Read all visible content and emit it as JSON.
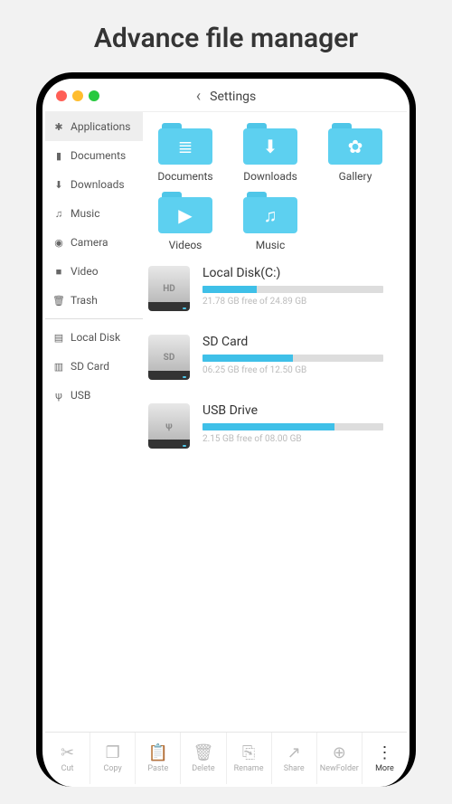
{
  "page_title": "Advance file manager",
  "topbar": {
    "label": "Settings"
  },
  "sidebar": {
    "primary": [
      {
        "icon": "✱",
        "label": "Applications",
        "active": true
      },
      {
        "icon": "▮",
        "label": "Documents"
      },
      {
        "icon": "⬇",
        "label": "Downloads"
      },
      {
        "icon": "♫",
        "label": "Music"
      },
      {
        "icon": "◉",
        "label": "Camera"
      },
      {
        "icon": "■",
        "label": "Video"
      },
      {
        "icon": "🗑",
        "label": "Trash"
      }
    ],
    "storage": [
      {
        "icon": "▤",
        "label": "Local Disk"
      },
      {
        "icon": "▥",
        "label": "SD Card"
      },
      {
        "icon": "ψ",
        "label": "USB"
      }
    ]
  },
  "folders": [
    {
      "name": "Documents",
      "glyph": "≣"
    },
    {
      "name": "Downloads",
      "glyph": "⬇"
    },
    {
      "name": "Gallery",
      "glyph": "✿"
    },
    {
      "name": "Videos",
      "glyph": "▶"
    },
    {
      "name": "Music",
      "glyph": "♫"
    }
  ],
  "drives": [
    {
      "badge": "HD",
      "name": "Local Disk(C:)",
      "free_text": "21.78 GB free of 24.89 GB",
      "pct": 30
    },
    {
      "badge": "SD",
      "name": "SD Card",
      "free_text": "06.25 GB free of 12.50 GB",
      "pct": 50
    },
    {
      "badge": "ψ",
      "name": "USB Drive",
      "free_text": "2.15 GB free of 08.00 GB",
      "pct": 73
    }
  ],
  "toolbar": [
    {
      "icon": "✂",
      "label": "Cut"
    },
    {
      "icon": "❐",
      "label": "Copy"
    },
    {
      "icon": "📋",
      "label": "Paste"
    },
    {
      "icon": "🗑",
      "label": "Delete"
    },
    {
      "icon": "⎘",
      "label": "Rename"
    },
    {
      "icon": "↗",
      "label": "Share"
    },
    {
      "icon": "⊕",
      "label": "NewFolder"
    },
    {
      "icon": "⋮",
      "label": "More",
      "more": true
    }
  ]
}
